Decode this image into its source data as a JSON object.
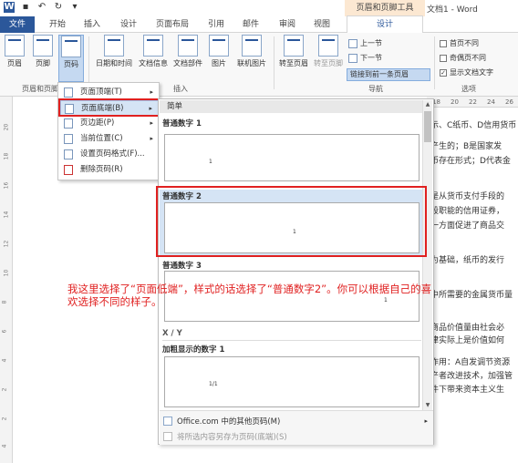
{
  "window": {
    "title": "文档1 - Word",
    "context_group": "页眉和页脚工具"
  },
  "tabs": [
    "文件",
    "开始",
    "插入",
    "设计",
    "页面布局",
    "引用",
    "邮件",
    "审阅",
    "视图",
    "设计"
  ],
  "ribbon": {
    "header_footer": {
      "header": "页眉",
      "footer": "页脚",
      "page_number": "页码",
      "group": "页眉和页脚"
    },
    "insert": {
      "datetime": "日期和时间",
      "docinfo": "文档信息",
      "docparts": "文档部件",
      "picture": "图片",
      "online_picture": "联机图片",
      "group": "插入"
    },
    "nav": {
      "goto_header": "转至页眉",
      "goto_footer": "转至页脚",
      "prev": "上一节",
      "next": "下一节",
      "link_prev": "链接到前一条页眉",
      "group": "导航"
    },
    "options": {
      "first_page": "首页不同",
      "odd_even": "奇偶页不同",
      "show_text": "显示文档文字",
      "group": "选项"
    }
  },
  "ruler_top": [
    "18",
    "20",
    "22",
    "24",
    "26"
  ],
  "ruler_left": [
    "20",
    "18",
    "16",
    "14",
    "12",
    "10",
    "8",
    "6",
    "4",
    "2",
    "2",
    "4"
  ],
  "menu": [
    {
      "label": "页面顶端(T)",
      "arrow": "▸"
    },
    {
      "label": "页面底端(B)",
      "arrow": "▸"
    },
    {
      "label": "页边距(P)",
      "arrow": "▸"
    },
    {
      "label": "当前位置(C)",
      "arrow": "▸"
    },
    {
      "label": "设置页码格式(F)..."
    },
    {
      "label": "删除页码(R)"
    }
  ],
  "gallery": {
    "head": "简单",
    "items": [
      "普通数字 1",
      "普通数字 2",
      "普通数字 3"
    ],
    "section2": "X / Y",
    "item4": "加粗显示的数字 1",
    "footer1": "Office.com 中的其他页码(M)",
    "footer2": "将所选内容另存为页码(底端)(S)"
  },
  "doc_lines": [
    "示、C纸币、D信用货币",
    "产生的；B是国家发",
    "币存在形式；D代表金",
    "是从货币支付手段的",
    "段职能的信用证券，",
    "一方面促进了商品交",
    "为基础，纸币的发行",
    "中所需要的金属货币量",
    "商品价值量由社会必",
    "律实际上是价值如何",
    "作用：A自发调节资源",
    "产者改进技术，加强管",
    "件下带来资本主义生"
  ],
  "annotation": "我这里选择了“页面低端”，样式的话选择了“普通数字2”。你可以根据自己的喜欢选择不同的样子。"
}
